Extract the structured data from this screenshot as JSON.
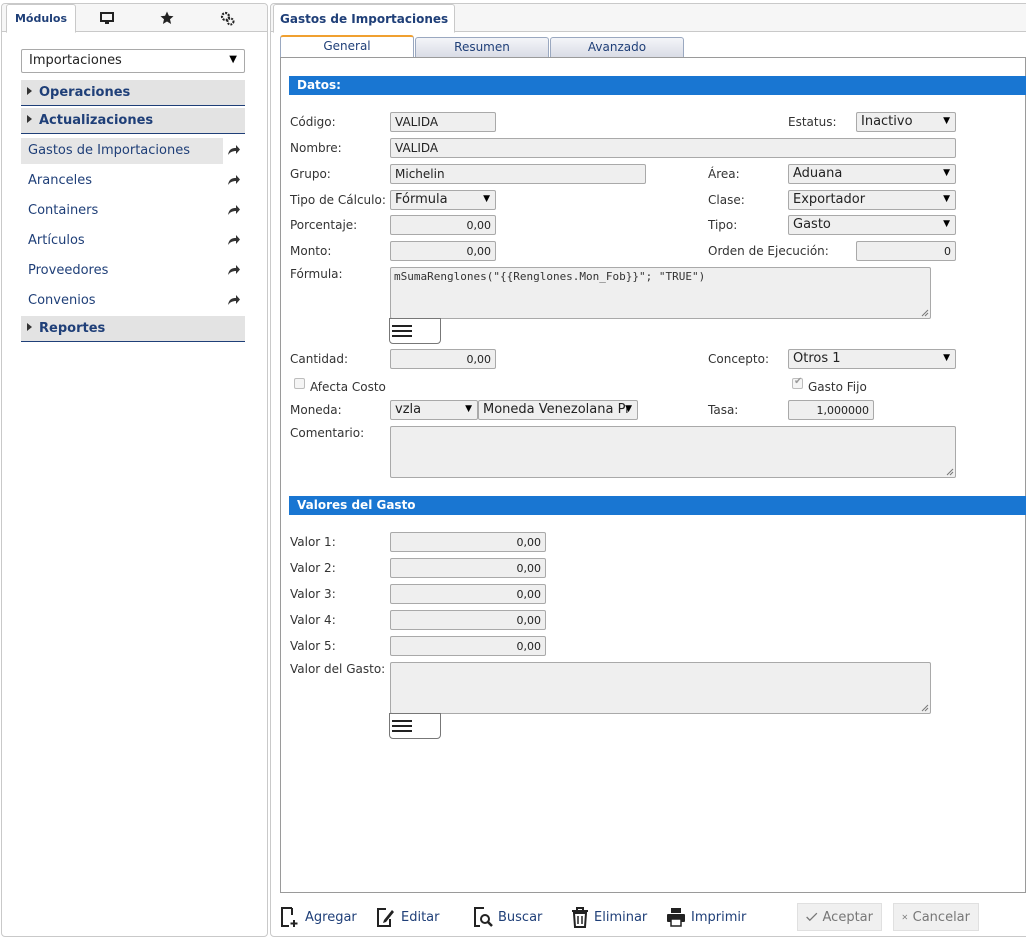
{
  "left": {
    "tabs": {
      "modulos": "Módulos"
    },
    "module_select": "Importaciones",
    "sections": {
      "operaciones": "Operaciones",
      "actualizaciones": "Actualizaciones",
      "reportes": "Reportes"
    },
    "items": [
      "Gastos de Importaciones",
      "Aranceles",
      "Containers",
      "Artículos",
      "Proveedores",
      "Convenios"
    ]
  },
  "right": {
    "tab_title": "Gastos de Importaciones",
    "subtabs": {
      "general": "General",
      "resumen": "Resumen",
      "avanzado": "Avanzado"
    }
  },
  "datos": {
    "header": "Datos:",
    "codigo_label": "Código:",
    "codigo": "VALIDA",
    "estatus_label": "Estatus:",
    "estatus": "Inactivo",
    "nombre_label": "Nombre:",
    "nombre": "VALIDA",
    "grupo_label": "Grupo:",
    "grupo": "Michelin",
    "area_label": "Área:",
    "area": "Aduana",
    "tipo_calculo_label": "Tipo de Cálculo:",
    "tipo_calculo": "Fórmula",
    "clase_label": "Clase:",
    "clase": "Exportador",
    "porcentaje_label": "Porcentaje:",
    "porcentaje": "0,00",
    "tipo_label": "Tipo:",
    "tipo": "Gasto",
    "monto_label": "Monto:",
    "monto": "0,00",
    "orden_label": "Orden de Ejecución:",
    "orden": "0",
    "formula_label": "Fórmula:",
    "formula": "mSumaRenglones(\"{{Renglones.Mon_Fob}}\"; \"TRUE\")",
    "cantidad_label": "Cantidad:",
    "cantidad": "0,00",
    "concepto_label": "Concepto:",
    "concepto": "Otros 1",
    "afecta_costo": "Afecta Costo",
    "afecta_costo_checked": false,
    "gasto_fijo": "Gasto Fijo",
    "gasto_fijo_checked": true,
    "moneda_label": "Moneda:",
    "moneda_codigo": "vzla",
    "moneda_nombre": "Moneda Venezolana Pr",
    "tasa_label": "Tasa:",
    "tasa": "1,000000",
    "comentario_label": "Comentario:",
    "comentario": ""
  },
  "valores": {
    "header": "Valores del Gasto",
    "v1_label": "Valor 1:",
    "v1": "0,00",
    "v2_label": "Valor 2:",
    "v2": "0,00",
    "v3_label": "Valor 3:",
    "v3": "0,00",
    "v4_label": "Valor 4:",
    "v4": "0,00",
    "v5_label": "Valor 5:",
    "v5": "0,00",
    "valor_gasto_label": "Valor del Gasto:",
    "valor_gasto": ""
  },
  "toolbar": {
    "agregar": "Agregar",
    "editar": "Editar",
    "buscar": "Buscar",
    "eliminar": "Eliminar",
    "imprimir": "Imprimir",
    "aceptar": "Aceptar",
    "cancelar": "Cancelar"
  },
  "icons": [
    "monitor-icon",
    "star-icon",
    "gears-icon",
    "arrow-go-icon",
    "menu-icon",
    "add-icon",
    "edit-icon",
    "search-icon",
    "trash-icon",
    "print-icon",
    "check-icon",
    "close-icon"
  ],
  "colors": {
    "accent": "#1976d2",
    "nav_text": "#1f3f78",
    "active_tab": "#f0a030"
  }
}
